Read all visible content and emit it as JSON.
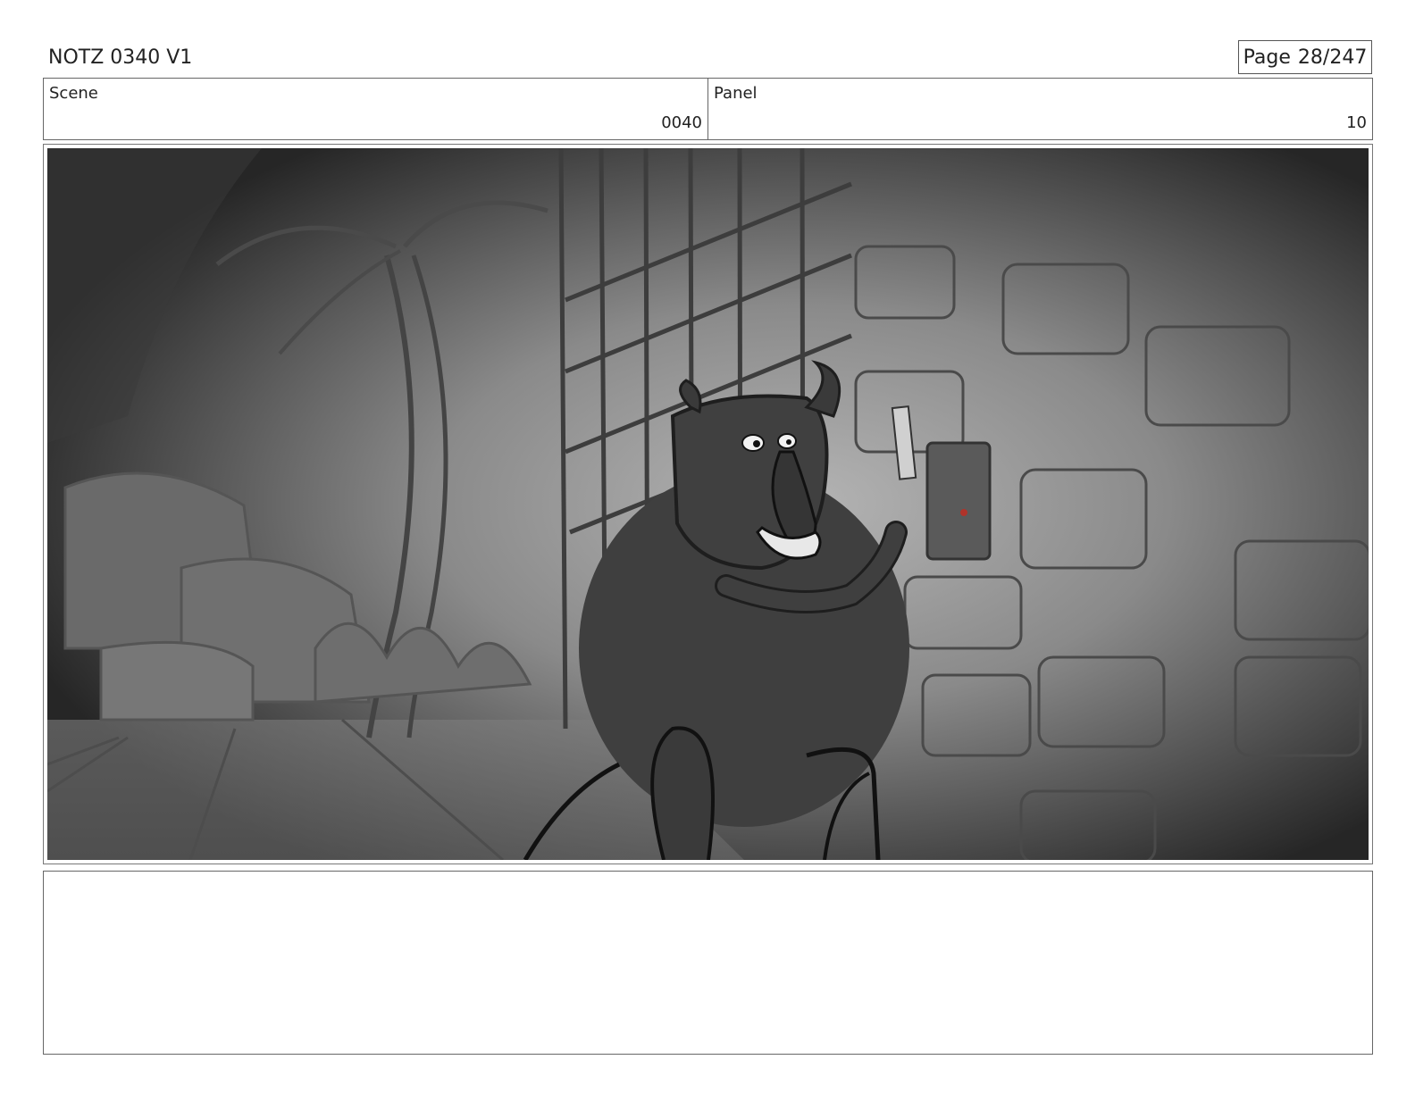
{
  "header": {
    "title": "NOTZ 0340 V1",
    "page_label": "Page",
    "page_number": "28/247"
  },
  "meta": {
    "scene_label": "Scene",
    "scene_value": "0040",
    "panel_label": "Panel",
    "panel_value": "10"
  },
  "notes": {
    "text": ""
  }
}
